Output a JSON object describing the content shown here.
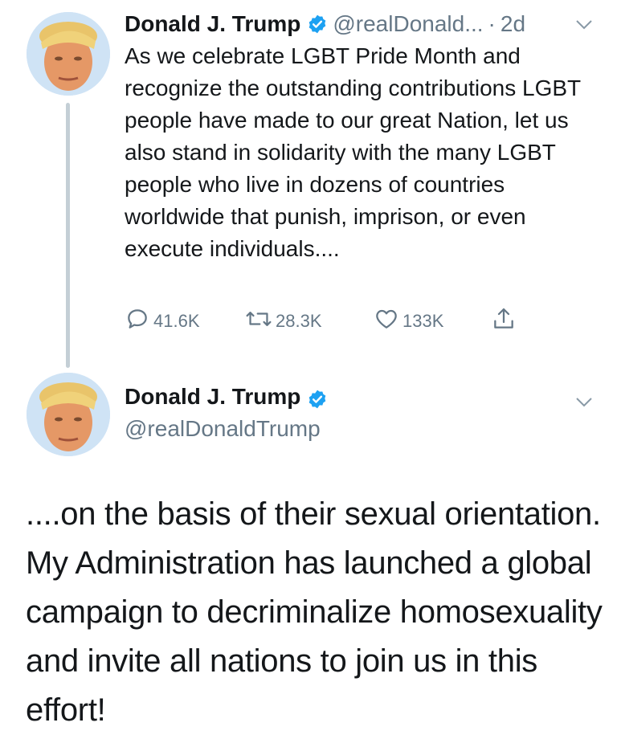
{
  "tweet1": {
    "name": "Donald J. Trump",
    "handle": "@realDonald...",
    "separator": "·",
    "time": "2d",
    "text": "As we celebrate LGBT Pride Month and recognize the outstanding contributions LGBT people have made to our great Nation, let us also stand in solidarity with the many LGBT people who live in dozens of countries worldwide that punish, imprison, or even execute individuals....",
    "replies": "41.6K",
    "retweets": "28.3K",
    "likes": "133K"
  },
  "tweet2": {
    "name": "Donald J. Trump",
    "handle": "@realDonaldTrump",
    "text": "....on the basis of their sexual orientation. My Administration has launched a global campaign to decriminalize homosexuality and invite all nations to join us in this effort!"
  },
  "colors": {
    "text": "#14171a",
    "secondary": "#657786",
    "verified": "#1da1f2",
    "thread_line": "#c4cfd6"
  },
  "icons": [
    "verified-badge-icon",
    "chevron-down-icon",
    "reply-icon",
    "retweet-icon",
    "like-icon",
    "share-icon"
  ]
}
